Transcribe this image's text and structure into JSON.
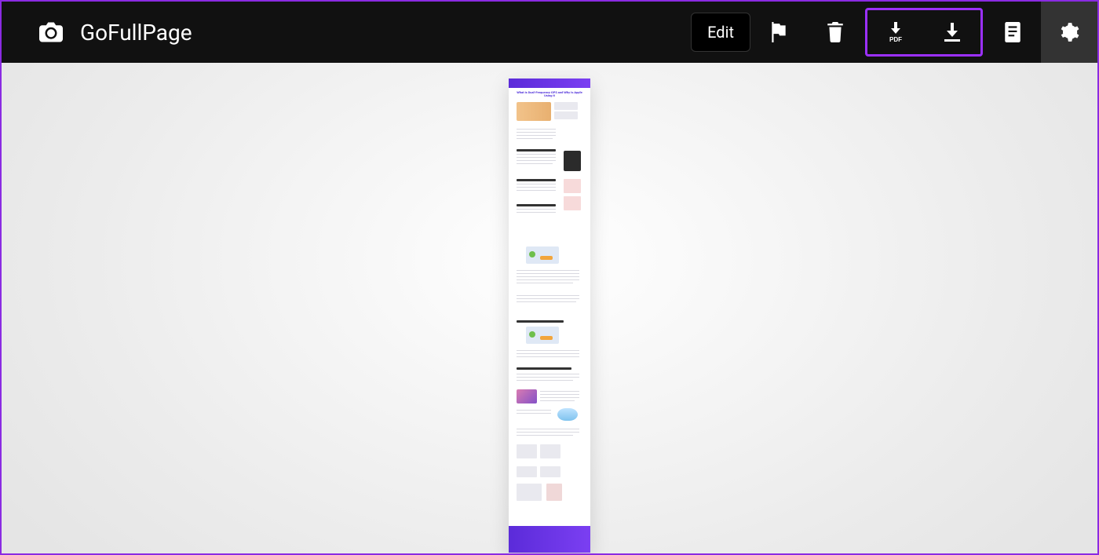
{
  "app": {
    "title": "GoFullPage"
  },
  "toolbar": {
    "edit_label": "Edit",
    "icons": {
      "camera": "camera-icon",
      "flag": "flag-icon",
      "trash": "trash-icon",
      "pdf": "download-pdf-icon",
      "download": "download-image-icon",
      "files": "files-icon",
      "settings": "settings-icon"
    }
  },
  "preview": {
    "captured_page_title": "What Is Dual-Frequency GPS and Why Is Apple Using It"
  },
  "colors": {
    "highlight": "#9b30ff",
    "frame_border": "#8a2be2",
    "toolbar_bg": "#111111"
  }
}
